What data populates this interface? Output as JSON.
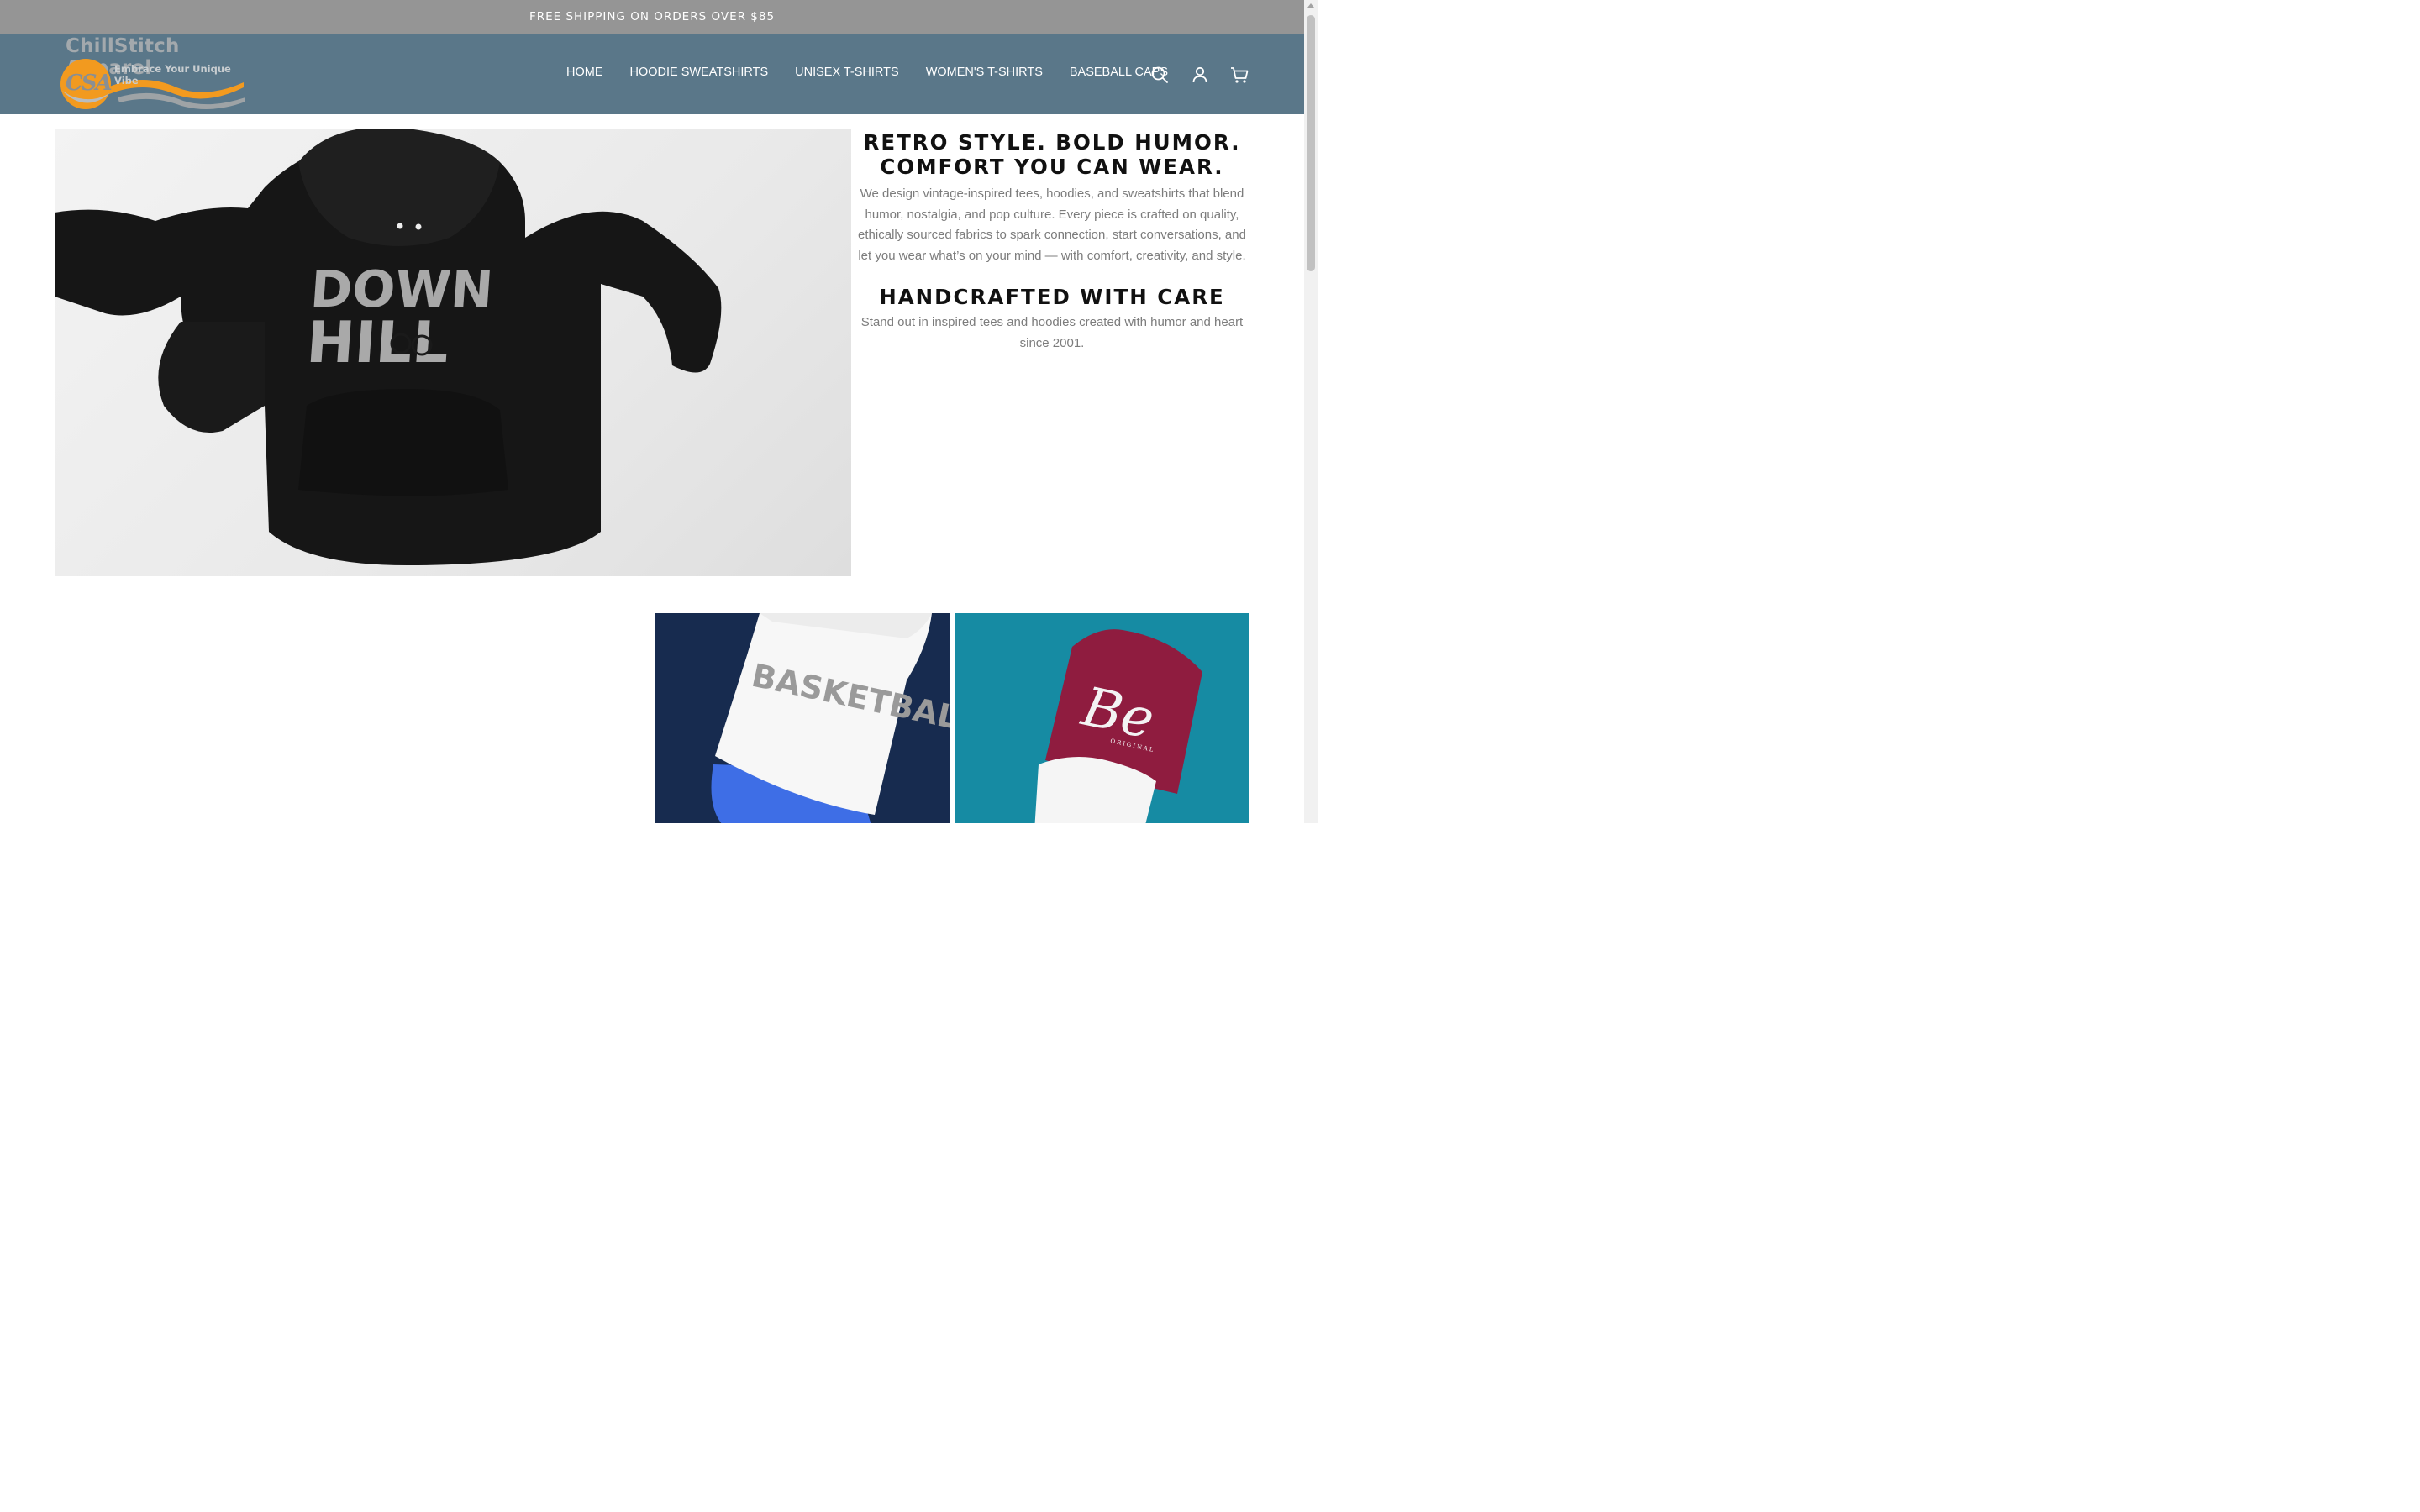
{
  "announcement": "FREE SHIPPING ON ORDERS OVER $85",
  "brand": {
    "name": "ChillStitch Apparel",
    "tagline": "Embrace Your Unique Vibe",
    "monogram": "CSA"
  },
  "nav": {
    "items": [
      {
        "label": "HOME"
      },
      {
        "label": "HOODIE SWEATSHIRTS"
      },
      {
        "label": "UNISEX T-SHIRTS"
      },
      {
        "label": "WOMEN'S T-SHIRTS"
      },
      {
        "label": "BASEBALL CAPS"
      }
    ],
    "icons": [
      "search-icon",
      "account-icon",
      "cart-icon"
    ]
  },
  "hero": {
    "image_text": {
      "line1": "DOWN",
      "line2": "HILL"
    },
    "heading_1_line1": "RETRO STYLE. BOLD HUMOR.",
    "heading_1_line2": "COMFORT YOU CAN WEAR.",
    "paragraph_1": "We design vintage-inspired tees, hoodies, and sweatshirts that blend humor, nostalgia, and pop culture. Every piece is crafted on quality, ethically sourced fabrics to spark connection, start conversations, and let you wear what’s on your mind — with comfort, creativity, and style.",
    "heading_2": "HANDCRAFTED WITH CARE",
    "paragraph_2": "Stand out in inspired tees and hoodies created with humor and heart since 2001."
  },
  "collections": [
    {
      "image_text": "BASKETBALL",
      "background": "#172b4f"
    },
    {
      "image_text": "Be",
      "subtext": "ORIGINAL",
      "background": "#168ba3"
    }
  ],
  "colors": {
    "announcement_bg": "#959595",
    "header_bg": "#5a7789",
    "logo_accent": "#f29a1f"
  }
}
